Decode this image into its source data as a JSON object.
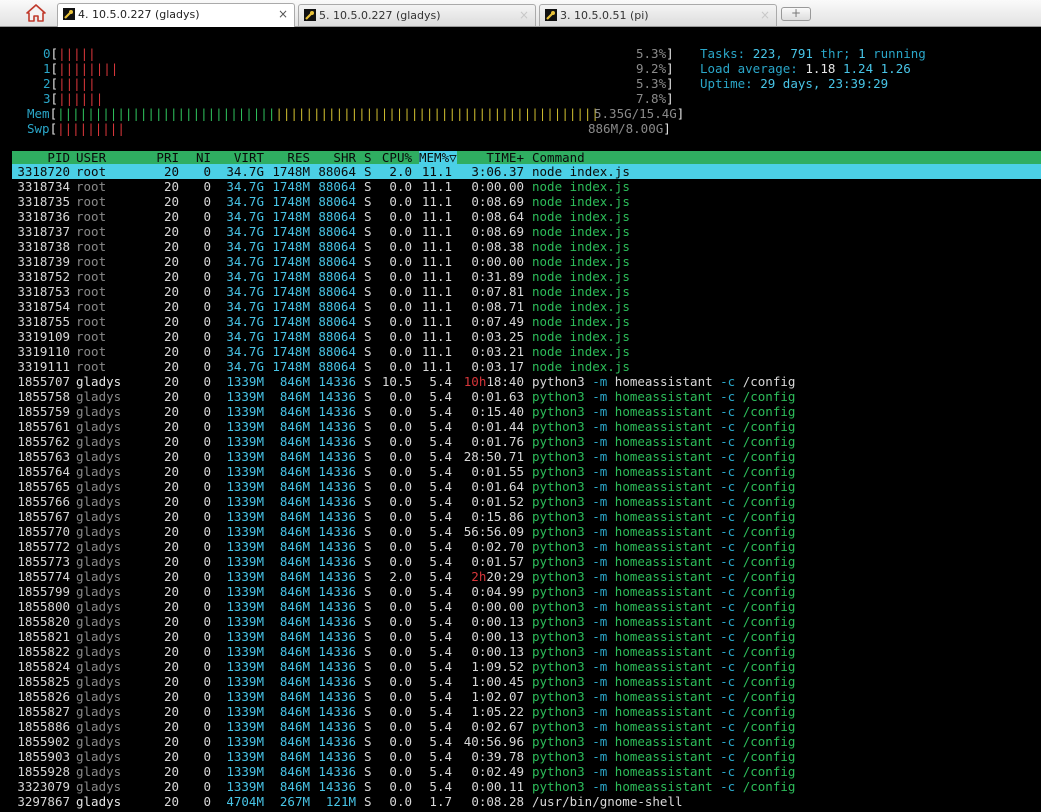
{
  "tabs": [
    {
      "label": "4. 10.5.0.227 (gladys)",
      "active": true
    },
    {
      "label": "5. 10.5.0.227 (gladys)",
      "active": false
    },
    {
      "label": "3. 10.5.0.51 (pi)",
      "active": false
    }
  ],
  "icons": {
    "home": "home-icon",
    "tab": "wrench-icon",
    "close": "close-icon",
    "new_tab": "new-tab-icon"
  },
  "close_glyph": "×",
  "new_tab_glyph": "+",
  "meters": {
    "cpu": [
      {
        "label": "0",
        "value": "5.3%",
        "bars": "|||||",
        "color": "red"
      },
      {
        "label": "1",
        "value": "9.2%",
        "bars": "||||||||",
        "color": "red"
      },
      {
        "label": "2",
        "value": "5.3%",
        "bars": "|||||",
        "color": "red"
      },
      {
        "label": "3",
        "value": "7.8%",
        "bars": "||||||",
        "color": "red"
      }
    ],
    "mem": {
      "label": "Mem",
      "value": "5.35G/15.4G"
    },
    "swp": {
      "label": "Swp",
      "value": "886M/8.00G"
    }
  },
  "info": {
    "tasks_label": "Tasks: ",
    "tasks": "223",
    "thr": "791",
    "thr_label": " thr; ",
    "running": "1",
    "running_label": " running",
    "load_label": "Load average: ",
    "load1": "1.18",
    "load5": "1.24",
    "load15": "1.26",
    "uptime_label": "Uptime: ",
    "uptime": "29 days, 23:39:29"
  },
  "header": {
    "pid": "PID",
    "user": "USER",
    "pri": "PRI",
    "ni": "NI",
    "virt": "VIRT",
    "res": "RES",
    "shr": "SHR",
    "s": "S",
    "cpu": "CPU%",
    "mem": "MEM%▽",
    "time": "TIME+",
    "cmd": "Command"
  },
  "processes": [
    {
      "pid": "3318720",
      "user": "root",
      "pri": "20",
      "ni": "0",
      "virt": "34.7G",
      "res": "1748M",
      "shr": "88064",
      "s": "S",
      "cpu": "2.0",
      "mem": "11.1",
      "time": "3:06.37",
      "cmd": "node index.js",
      "selected": true
    },
    {
      "pid": "3318734",
      "user": "root",
      "pri": "20",
      "ni": "0",
      "virt": "34.7G",
      "res": "1748M",
      "shr": "88064",
      "s": "S",
      "cpu": "0.0",
      "mem": "11.1",
      "time": "0:00.00",
      "cmd": "node index.js"
    },
    {
      "pid": "3318735",
      "user": "root",
      "pri": "20",
      "ni": "0",
      "virt": "34.7G",
      "res": "1748M",
      "shr": "88064",
      "s": "S",
      "cpu": "0.0",
      "mem": "11.1",
      "time": "0:08.69",
      "cmd": "node index.js"
    },
    {
      "pid": "3318736",
      "user": "root",
      "pri": "20",
      "ni": "0",
      "virt": "34.7G",
      "res": "1748M",
      "shr": "88064",
      "s": "S",
      "cpu": "0.0",
      "mem": "11.1",
      "time": "0:08.64",
      "cmd": "node index.js"
    },
    {
      "pid": "3318737",
      "user": "root",
      "pri": "20",
      "ni": "0",
      "virt": "34.7G",
      "res": "1748M",
      "shr": "88064",
      "s": "S",
      "cpu": "0.0",
      "mem": "11.1",
      "time": "0:08.69",
      "cmd": "node index.js"
    },
    {
      "pid": "3318738",
      "user": "root",
      "pri": "20",
      "ni": "0",
      "virt": "34.7G",
      "res": "1748M",
      "shr": "88064",
      "s": "S",
      "cpu": "0.0",
      "mem": "11.1",
      "time": "0:08.38",
      "cmd": "node index.js"
    },
    {
      "pid": "3318739",
      "user": "root",
      "pri": "20",
      "ni": "0",
      "virt": "34.7G",
      "res": "1748M",
      "shr": "88064",
      "s": "S",
      "cpu": "0.0",
      "mem": "11.1",
      "time": "0:00.00",
      "cmd": "node index.js"
    },
    {
      "pid": "3318752",
      "user": "root",
      "pri": "20",
      "ni": "0",
      "virt": "34.7G",
      "res": "1748M",
      "shr": "88064",
      "s": "S",
      "cpu": "0.0",
      "mem": "11.1",
      "time": "0:31.89",
      "cmd": "node index.js"
    },
    {
      "pid": "3318753",
      "user": "root",
      "pri": "20",
      "ni": "0",
      "virt": "34.7G",
      "res": "1748M",
      "shr": "88064",
      "s": "S",
      "cpu": "0.0",
      "mem": "11.1",
      "time": "0:07.81",
      "cmd": "node index.js"
    },
    {
      "pid": "3318754",
      "user": "root",
      "pri": "20",
      "ni": "0",
      "virt": "34.7G",
      "res": "1748M",
      "shr": "88064",
      "s": "S",
      "cpu": "0.0",
      "mem": "11.1",
      "time": "0:08.71",
      "cmd": "node index.js"
    },
    {
      "pid": "3318755",
      "user": "root",
      "pri": "20",
      "ni": "0",
      "virt": "34.7G",
      "res": "1748M",
      "shr": "88064",
      "s": "S",
      "cpu": "0.0",
      "mem": "11.1",
      "time": "0:07.49",
      "cmd": "node index.js"
    },
    {
      "pid": "3319109",
      "user": "root",
      "pri": "20",
      "ni": "0",
      "virt": "34.7G",
      "res": "1748M",
      "shr": "88064",
      "s": "S",
      "cpu": "0.0",
      "mem": "11.1",
      "time": "0:03.25",
      "cmd": "node index.js"
    },
    {
      "pid": "3319110",
      "user": "root",
      "pri": "20",
      "ni": "0",
      "virt": "34.7G",
      "res": "1748M",
      "shr": "88064",
      "s": "S",
      "cpu": "0.0",
      "mem": "11.1",
      "time": "0:03.21",
      "cmd": "node index.js"
    },
    {
      "pid": "3319111",
      "user": "root",
      "pri": "20",
      "ni": "0",
      "virt": "34.7G",
      "res": "1748M",
      "shr": "88064",
      "s": "S",
      "cpu": "0.0",
      "mem": "11.1",
      "time": "0:03.17",
      "cmd": "node index.js"
    },
    {
      "pid": "1855707",
      "user": "gladys",
      "pri": "20",
      "ni": "0",
      "virt": "1339M",
      "res": "846M",
      "shr": "14336",
      "s": "S",
      "cpu": "10.5",
      "mem": "5.4",
      "time_hi": "10h",
      "time": "18:40",
      "cmd": "python3 -m homeassistant -c /config",
      "main": true
    },
    {
      "pid": "1855758",
      "user": "gladys",
      "pri": "20",
      "ni": "0",
      "virt": "1339M",
      "res": "846M",
      "shr": "14336",
      "s": "S",
      "cpu": "0.0",
      "mem": "5.4",
      "time": "0:01.63",
      "cmd": "python3 -m homeassistant -c /config"
    },
    {
      "pid": "1855759",
      "user": "gladys",
      "pri": "20",
      "ni": "0",
      "virt": "1339M",
      "res": "846M",
      "shr": "14336",
      "s": "S",
      "cpu": "0.0",
      "mem": "5.4",
      "time": "0:15.40",
      "cmd": "python3 -m homeassistant -c /config"
    },
    {
      "pid": "1855761",
      "user": "gladys",
      "pri": "20",
      "ni": "0",
      "virt": "1339M",
      "res": "846M",
      "shr": "14336",
      "s": "S",
      "cpu": "0.0",
      "mem": "5.4",
      "time": "0:01.44",
      "cmd": "python3 -m homeassistant -c /config"
    },
    {
      "pid": "1855762",
      "user": "gladys",
      "pri": "20",
      "ni": "0",
      "virt": "1339M",
      "res": "846M",
      "shr": "14336",
      "s": "S",
      "cpu": "0.0",
      "mem": "5.4",
      "time": "0:01.76",
      "cmd": "python3 -m homeassistant -c /config"
    },
    {
      "pid": "1855763",
      "user": "gladys",
      "pri": "20",
      "ni": "0",
      "virt": "1339M",
      "res": "846M",
      "shr": "14336",
      "s": "S",
      "cpu": "0.0",
      "mem": "5.4",
      "time": "28:50.71",
      "cmd": "python3 -m homeassistant -c /config"
    },
    {
      "pid": "1855764",
      "user": "gladys",
      "pri": "20",
      "ni": "0",
      "virt": "1339M",
      "res": "846M",
      "shr": "14336",
      "s": "S",
      "cpu": "0.0",
      "mem": "5.4",
      "time": "0:01.55",
      "cmd": "python3 -m homeassistant -c /config"
    },
    {
      "pid": "1855765",
      "user": "gladys",
      "pri": "20",
      "ni": "0",
      "virt": "1339M",
      "res": "846M",
      "shr": "14336",
      "s": "S",
      "cpu": "0.0",
      "mem": "5.4",
      "time": "0:01.64",
      "cmd": "python3 -m homeassistant -c /config"
    },
    {
      "pid": "1855766",
      "user": "gladys",
      "pri": "20",
      "ni": "0",
      "virt": "1339M",
      "res": "846M",
      "shr": "14336",
      "s": "S",
      "cpu": "0.0",
      "mem": "5.4",
      "time": "0:01.52",
      "cmd": "python3 -m homeassistant -c /config"
    },
    {
      "pid": "1855767",
      "user": "gladys",
      "pri": "20",
      "ni": "0",
      "virt": "1339M",
      "res": "846M",
      "shr": "14336",
      "s": "S",
      "cpu": "0.0",
      "mem": "5.4",
      "time": "0:15.86",
      "cmd": "python3 -m homeassistant -c /config"
    },
    {
      "pid": "1855770",
      "user": "gladys",
      "pri": "20",
      "ni": "0",
      "virt": "1339M",
      "res": "846M",
      "shr": "14336",
      "s": "S",
      "cpu": "0.0",
      "mem": "5.4",
      "time": "56:56.09",
      "cmd": "python3 -m homeassistant -c /config"
    },
    {
      "pid": "1855772",
      "user": "gladys",
      "pri": "20",
      "ni": "0",
      "virt": "1339M",
      "res": "846M",
      "shr": "14336",
      "s": "S",
      "cpu": "0.0",
      "mem": "5.4",
      "time": "0:02.70",
      "cmd": "python3 -m homeassistant -c /config"
    },
    {
      "pid": "1855773",
      "user": "gladys",
      "pri": "20",
      "ni": "0",
      "virt": "1339M",
      "res": "846M",
      "shr": "14336",
      "s": "S",
      "cpu": "0.0",
      "mem": "5.4",
      "time": "0:01.57",
      "cmd": "python3 -m homeassistant -c /config"
    },
    {
      "pid": "1855774",
      "user": "gladys",
      "pri": "20",
      "ni": "0",
      "virt": "1339M",
      "res": "846M",
      "shr": "14336",
      "s": "S",
      "cpu": "2.0",
      "mem": "5.4",
      "time_hi": "2h",
      "time": "20:29",
      "cmd": "python3 -m homeassistant -c /config"
    },
    {
      "pid": "1855799",
      "user": "gladys",
      "pri": "20",
      "ni": "0",
      "virt": "1339M",
      "res": "846M",
      "shr": "14336",
      "s": "S",
      "cpu": "0.0",
      "mem": "5.4",
      "time": "0:04.99",
      "cmd": "python3 -m homeassistant -c /config"
    },
    {
      "pid": "1855800",
      "user": "gladys",
      "pri": "20",
      "ni": "0",
      "virt": "1339M",
      "res": "846M",
      "shr": "14336",
      "s": "S",
      "cpu": "0.0",
      "mem": "5.4",
      "time": "0:00.00",
      "cmd": "python3 -m homeassistant -c /config"
    },
    {
      "pid": "1855820",
      "user": "gladys",
      "pri": "20",
      "ni": "0",
      "virt": "1339M",
      "res": "846M",
      "shr": "14336",
      "s": "S",
      "cpu": "0.0",
      "mem": "5.4",
      "time": "0:00.13",
      "cmd": "python3 -m homeassistant -c /config"
    },
    {
      "pid": "1855821",
      "user": "gladys",
      "pri": "20",
      "ni": "0",
      "virt": "1339M",
      "res": "846M",
      "shr": "14336",
      "s": "S",
      "cpu": "0.0",
      "mem": "5.4",
      "time": "0:00.13",
      "cmd": "python3 -m homeassistant -c /config"
    },
    {
      "pid": "1855822",
      "user": "gladys",
      "pri": "20",
      "ni": "0",
      "virt": "1339M",
      "res": "846M",
      "shr": "14336",
      "s": "S",
      "cpu": "0.0",
      "mem": "5.4",
      "time": "0:00.13",
      "cmd": "python3 -m homeassistant -c /config"
    },
    {
      "pid": "1855824",
      "user": "gladys",
      "pri": "20",
      "ni": "0",
      "virt": "1339M",
      "res": "846M",
      "shr": "14336",
      "s": "S",
      "cpu": "0.0",
      "mem": "5.4",
      "time": "1:09.52",
      "cmd": "python3 -m homeassistant -c /config"
    },
    {
      "pid": "1855825",
      "user": "gladys",
      "pri": "20",
      "ni": "0",
      "virt": "1339M",
      "res": "846M",
      "shr": "14336",
      "s": "S",
      "cpu": "0.0",
      "mem": "5.4",
      "time": "1:00.45",
      "cmd": "python3 -m homeassistant -c /config"
    },
    {
      "pid": "1855826",
      "user": "gladys",
      "pri": "20",
      "ni": "0",
      "virt": "1339M",
      "res": "846M",
      "shr": "14336",
      "s": "S",
      "cpu": "0.0",
      "mem": "5.4",
      "time": "1:02.07",
      "cmd": "python3 -m homeassistant -c /config"
    },
    {
      "pid": "1855827",
      "user": "gladys",
      "pri": "20",
      "ni": "0",
      "virt": "1339M",
      "res": "846M",
      "shr": "14336",
      "s": "S",
      "cpu": "0.0",
      "mem": "5.4",
      "time": "1:05.22",
      "cmd": "python3 -m homeassistant -c /config"
    },
    {
      "pid": "1855886",
      "user": "gladys",
      "pri": "20",
      "ni": "0",
      "virt": "1339M",
      "res": "846M",
      "shr": "14336",
      "s": "S",
      "cpu": "0.0",
      "mem": "5.4",
      "time": "0:02.67",
      "cmd": "python3 -m homeassistant -c /config"
    },
    {
      "pid": "1855902",
      "user": "gladys",
      "pri": "20",
      "ni": "0",
      "virt": "1339M",
      "res": "846M",
      "shr": "14336",
      "s": "S",
      "cpu": "0.0",
      "mem": "5.4",
      "time": "40:56.96",
      "cmd": "python3 -m homeassistant -c /config"
    },
    {
      "pid": "1855903",
      "user": "gladys",
      "pri": "20",
      "ni": "0",
      "virt": "1339M",
      "res": "846M",
      "shr": "14336",
      "s": "S",
      "cpu": "0.0",
      "mem": "5.4",
      "time": "0:39.78",
      "cmd": "python3 -m homeassistant -c /config"
    },
    {
      "pid": "1855928",
      "user": "gladys",
      "pri": "20",
      "ni": "0",
      "virt": "1339M",
      "res": "846M",
      "shr": "14336",
      "s": "S",
      "cpu": "0.0",
      "mem": "5.4",
      "time": "0:02.49",
      "cmd": "python3 -m homeassistant -c /config"
    },
    {
      "pid": "3323079",
      "user": "gladys",
      "pri": "20",
      "ni": "0",
      "virt": "1339M",
      "res": "846M",
      "shr": "14336",
      "s": "S",
      "cpu": "0.0",
      "mem": "5.4",
      "time": "0:00.11",
      "cmd": "python3 -m homeassistant -c /config"
    },
    {
      "pid": "3297867",
      "user": "gladys",
      "pri": "20",
      "ni": "0",
      "virt": "4704M",
      "res": "267M",
      "shr": "121M",
      "s": "S",
      "cpu": "0.0",
      "mem": "1.7",
      "time": "0:08.28",
      "cmd": "/usr/bin/gnome-shell",
      "main": true
    }
  ],
  "colors": {
    "header_bg": "#2fae61",
    "selection_bg": "#4bd0e6",
    "thread_cmd": "#2dbd5a",
    "info_cyan": "#2aa6c8",
    "cpu_bar": "#d6363a",
    "mem_used": "#2dbd5a",
    "mem_cache": "#c9b82e",
    "hi_time": "#d6363a"
  }
}
